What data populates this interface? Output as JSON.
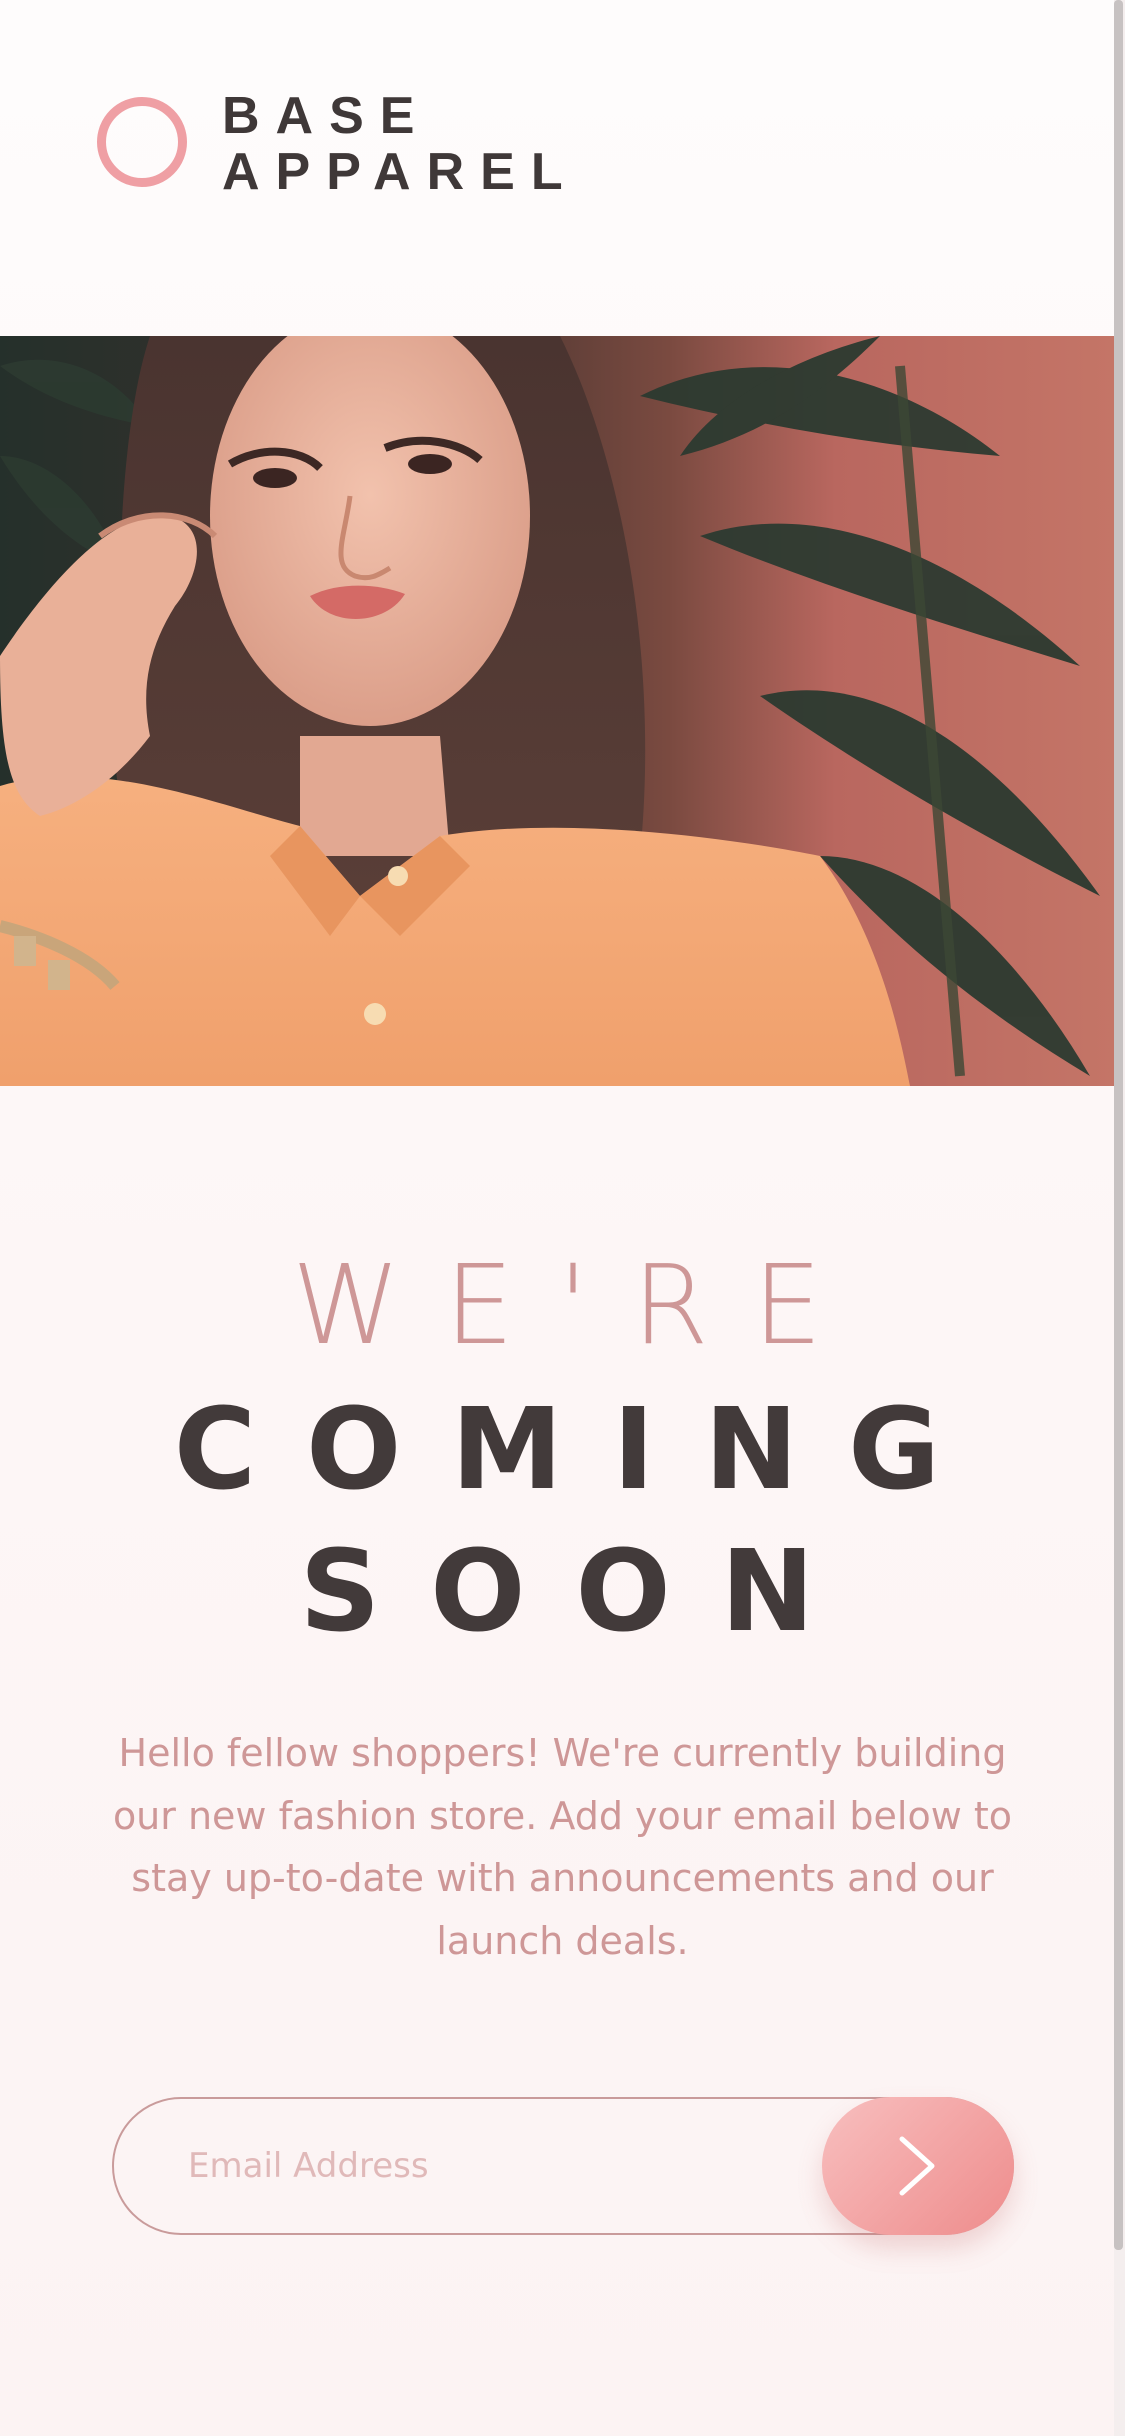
{
  "brand": {
    "line1": "BASE",
    "line2": "APPAREL",
    "ring_color": "#ef9fa4"
  },
  "hero": {
    "image": "woman-orange-shirt-photo"
  },
  "headline": {
    "line1": "WE'RE",
    "line2": "COMING",
    "line3": "SOON"
  },
  "description": "Hello fellow shoppers! We're currently building our new fashion store. Add your email below to stay up-to-date with announcements and our launch deals.",
  "form": {
    "email_placeholder": "Email Address",
    "email_value": "",
    "submit_icon": "arrow-right-icon"
  },
  "colors": {
    "accent": "#ce9797",
    "dark_text": "#423a3a",
    "button_gradient_start": "#f8bfbf",
    "button_gradient_end": "#ee8c8c"
  }
}
